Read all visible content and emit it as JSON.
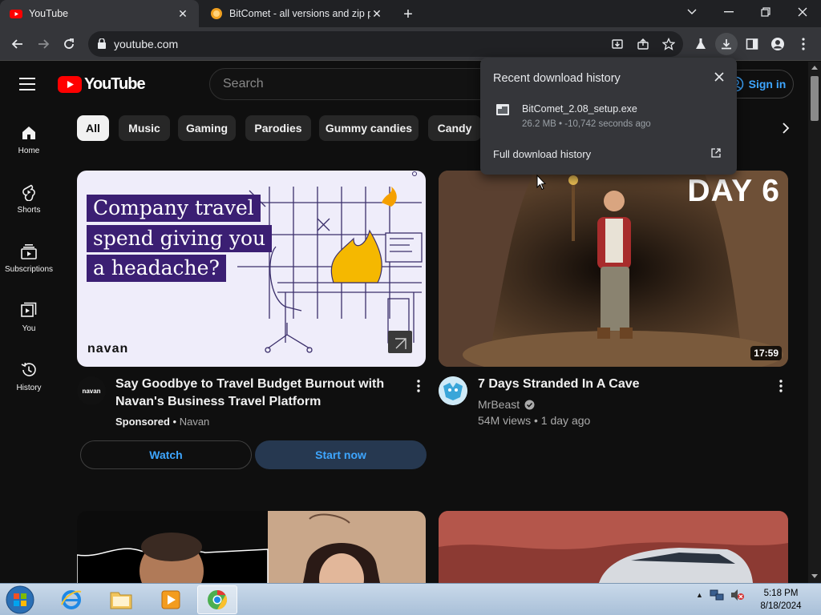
{
  "browser": {
    "tabs": [
      {
        "title": "YouTube",
        "active": true
      },
      {
        "title": "BitComet - all versions and zip p",
        "active": false
      }
    ],
    "url": "youtube.com"
  },
  "youtube": {
    "logo_text": "YouTube",
    "search_placeholder": "Search",
    "signin_label": "Sign in",
    "sidebar": [
      {
        "label": "Home",
        "icon": "home-icon"
      },
      {
        "label": "Shorts",
        "icon": "shorts-icon"
      },
      {
        "label": "Subscriptions",
        "icon": "subscriptions-icon"
      },
      {
        "label": "You",
        "icon": "you-icon"
      },
      {
        "label": "History",
        "icon": "history-icon"
      }
    ],
    "chips": [
      "All",
      "Music",
      "Gaming",
      "Parodies",
      "Gummy candies",
      "Candy"
    ],
    "videos": [
      {
        "title_line1": "Say Goodbye to Travel Budget Burnout with",
        "title_line2": "Navan's Business Travel Platform",
        "sponsored": "Sponsored",
        "channel": "Navan",
        "ad_line1": "Company travel",
        "ad_line2": "spend giving you",
        "ad_line3": "a headache?",
        "brand": "navan",
        "watch_label": "Watch",
        "start_label": "Start now"
      },
      {
        "title": "7 Days Stranded In A Cave",
        "channel": "MrBeast",
        "stats": "54M views • 1 day ago",
        "duration": "17:59",
        "thumb_text": "DAY 6"
      }
    ]
  },
  "downloads": {
    "heading": "Recent download history",
    "file_name": "BitComet_2.08_setup.exe",
    "file_meta": "26.2 MB • -10,742 seconds ago",
    "full_history": "Full download history"
  },
  "taskbar": {
    "time": "5:18 PM",
    "date": "8/18/2024"
  },
  "colors": {
    "yt_red": "#ff0000",
    "link_blue": "#3ea6ff",
    "background": "#0f0f0f"
  }
}
